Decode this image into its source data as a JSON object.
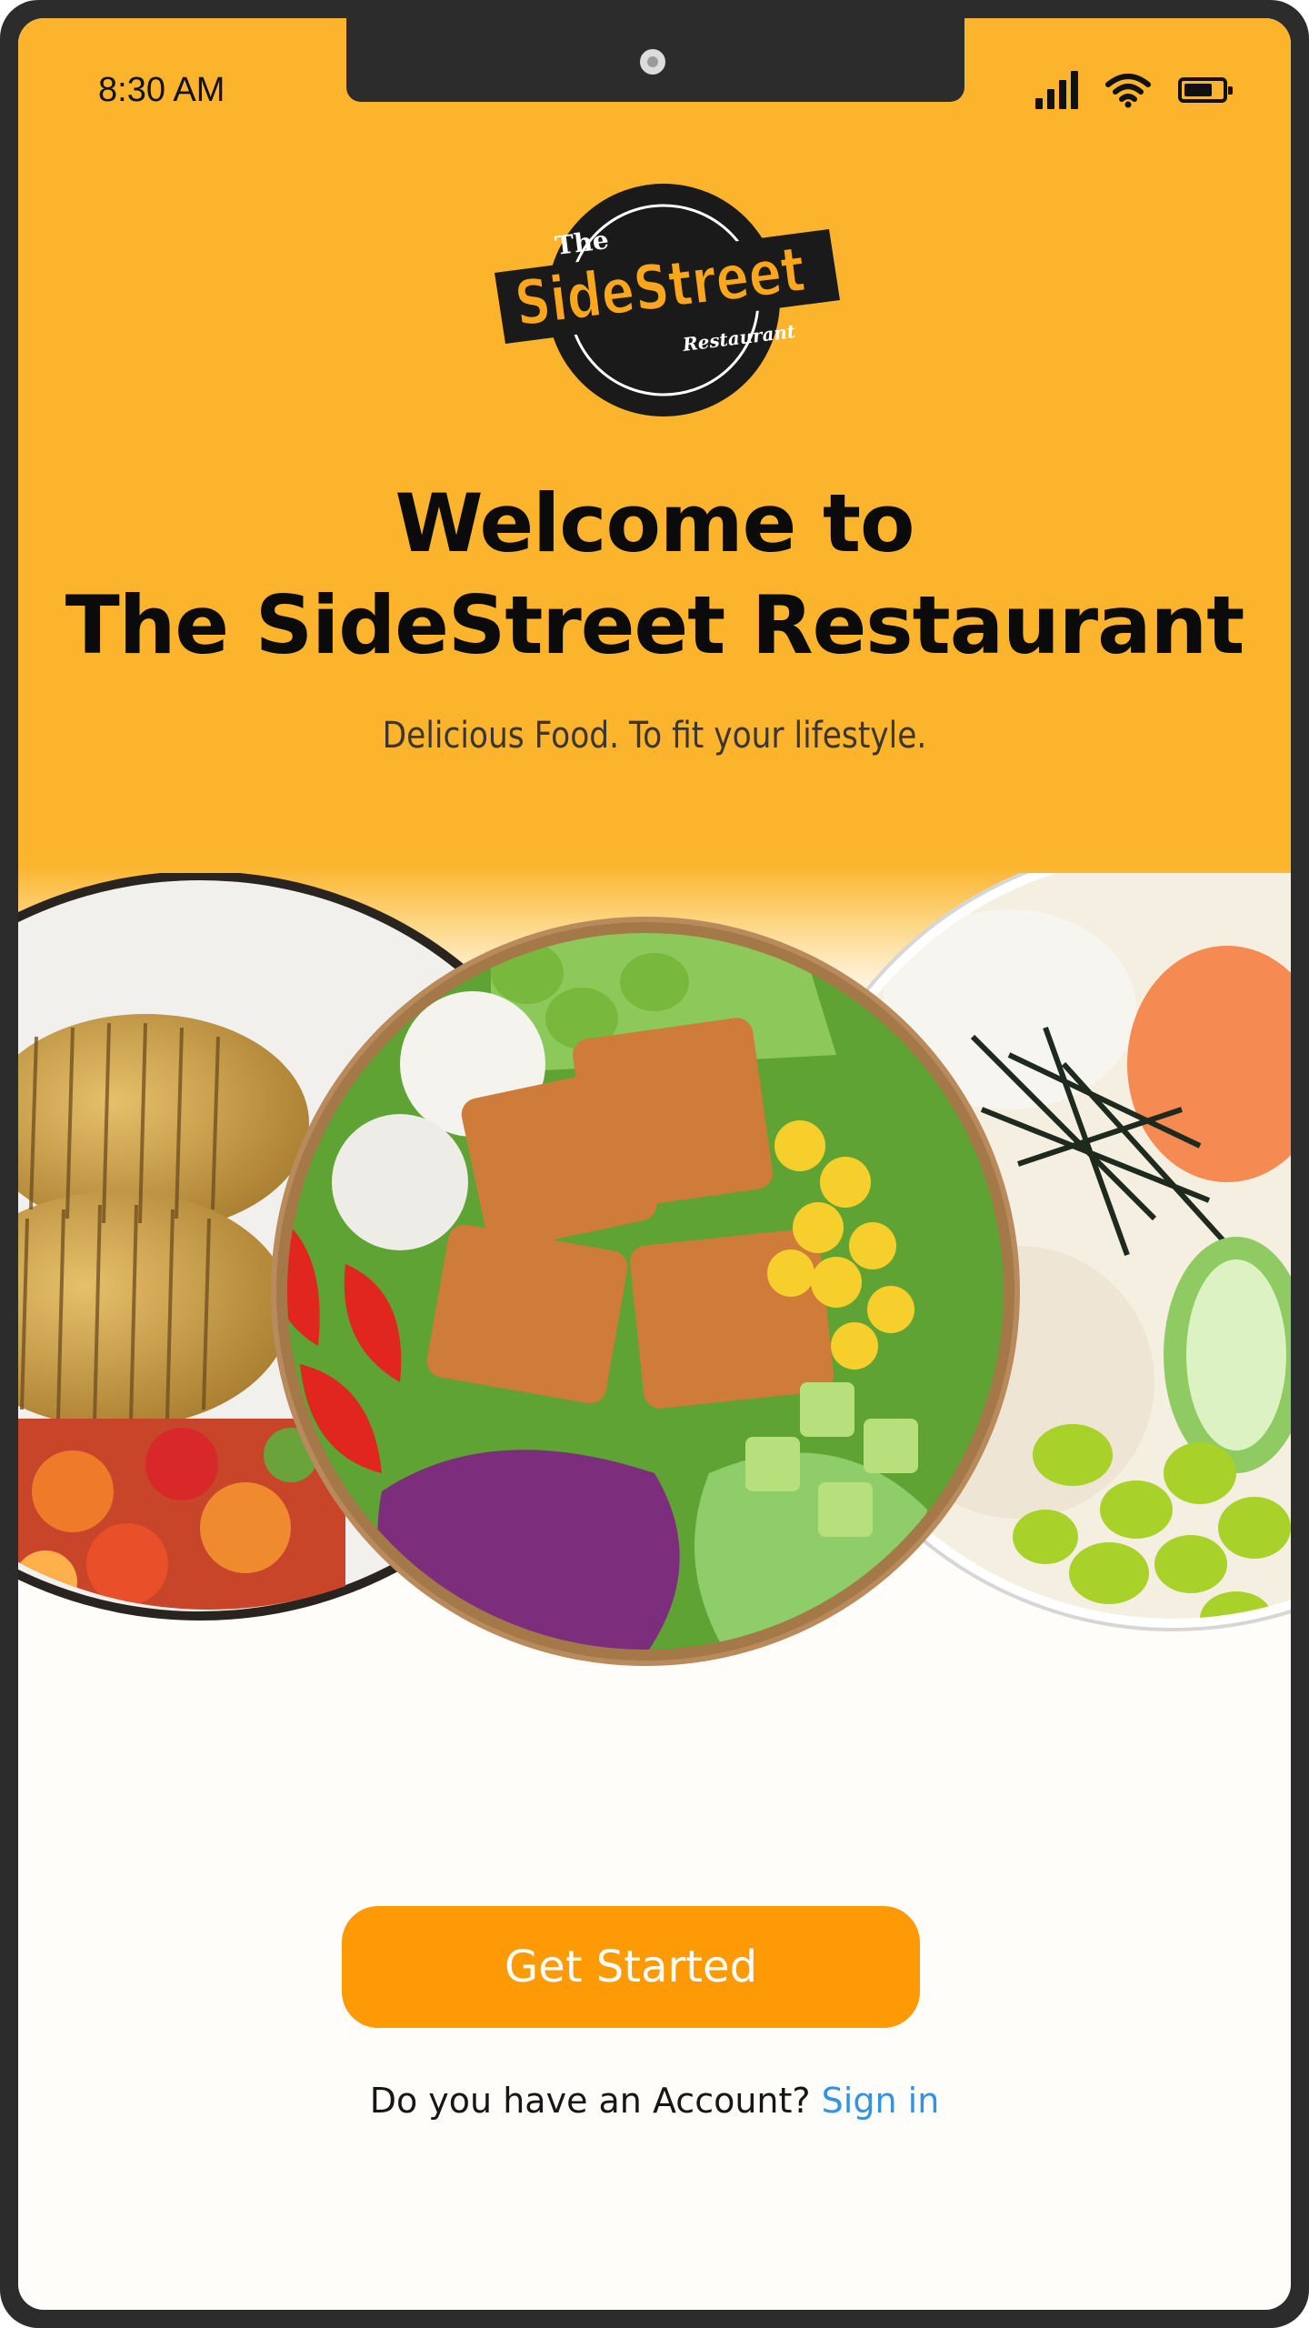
{
  "status_bar": {
    "time": "8:30 AM",
    "icons": [
      "signal-icon",
      "wifi-icon",
      "battery-icon"
    ]
  },
  "logo": {
    "top_text": "The",
    "brand_text": "SideStreet",
    "sub_text": "Restaurant"
  },
  "hero": {
    "title_line1": "Welcome to",
    "title_line2": "The SideStreet Restaurant",
    "tagline": "Delicious Food. To fit your lifestyle."
  },
  "images": [
    "hasselback-potatoes-plate",
    "tofu-salad-bowl",
    "poke-bowl"
  ],
  "actions": {
    "get_started_label": "Get Started",
    "account_prompt": "Do you have an Account?",
    "sign_in_label": "Sign in"
  },
  "colors": {
    "background_yellow": "#fbb42c",
    "button_orange": "#fe9a06",
    "link_blue": "#3393e0",
    "text_dark": "#0b0b0b"
  }
}
